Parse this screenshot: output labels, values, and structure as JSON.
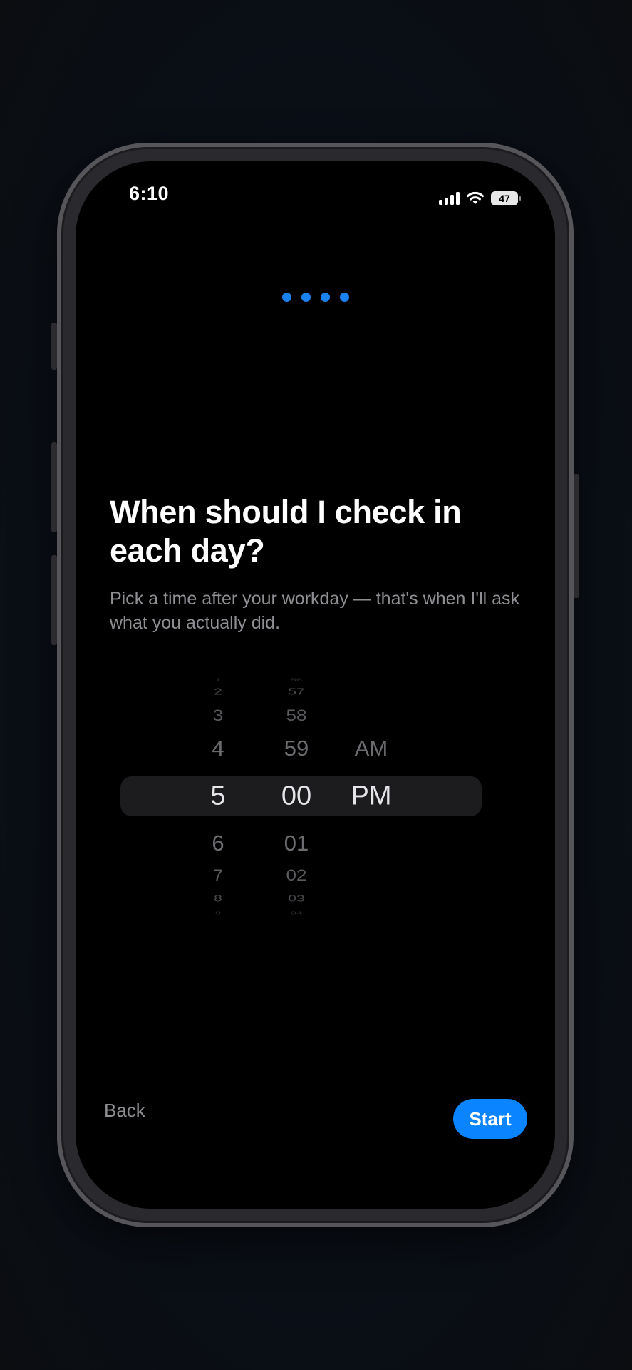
{
  "status_bar": {
    "time": "6:10",
    "battery": "47",
    "icons": [
      "cellular-signal-icon",
      "wifi-icon",
      "battery-icon"
    ]
  },
  "progress": {
    "steps_total": 4,
    "steps_completed": 4,
    "color": "#1a82f0"
  },
  "heading": "When should I check in each day?",
  "subheading": "Pick a time after your workday — that's when I'll ask what you actually did.",
  "time_picker": {
    "hour": {
      "selected": "5",
      "items": [
        "1",
        "2",
        "3",
        "4",
        "5",
        "6",
        "7",
        "8",
        "9"
      ]
    },
    "minute": {
      "selected": "00",
      "items": [
        "56",
        "57",
        "58",
        "59",
        "00",
        "01",
        "02",
        "03",
        "04"
      ]
    },
    "period": {
      "selected": "PM",
      "items": [
        "AM",
        "PM"
      ]
    }
  },
  "actions": {
    "back_label": "Back",
    "start_label": "Start",
    "accent_color": "#0a84ff"
  }
}
